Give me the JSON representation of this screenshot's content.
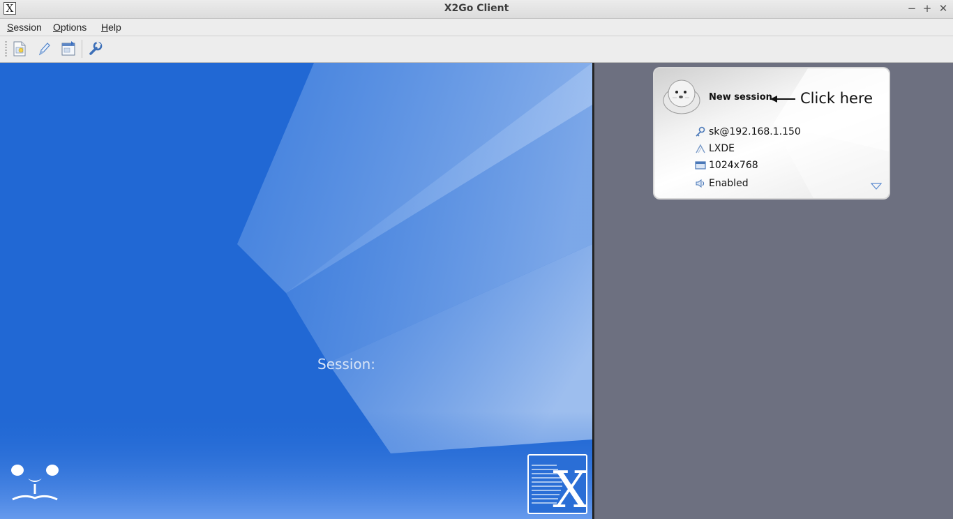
{
  "window": {
    "title": "X2Go Client",
    "icon_letter": "X",
    "controls": [
      "−",
      "+",
      "✕"
    ]
  },
  "menubar": {
    "items": [
      {
        "label_u": "S",
        "label_rest": "ession"
      },
      {
        "label_u": "O",
        "label_rest": "ptions"
      },
      {
        "label_u": "H",
        "label_rest": "elp"
      }
    ]
  },
  "toolbar": {
    "buttons": [
      "new-session-icon",
      "edit-session-icon",
      "create-shortcut-icon",
      "settings-wrench-icon"
    ]
  },
  "left_pane": {
    "session_label": "Session:"
  },
  "session_card": {
    "name": "New session",
    "annotation": "Click here",
    "server": "sk@192.168.1.150",
    "desktop": "LXDE",
    "resolution": "1024x768",
    "sound": "Enabled"
  },
  "colors": {
    "accent_blue": "#2168d4",
    "right_pane": "#6d7080"
  }
}
